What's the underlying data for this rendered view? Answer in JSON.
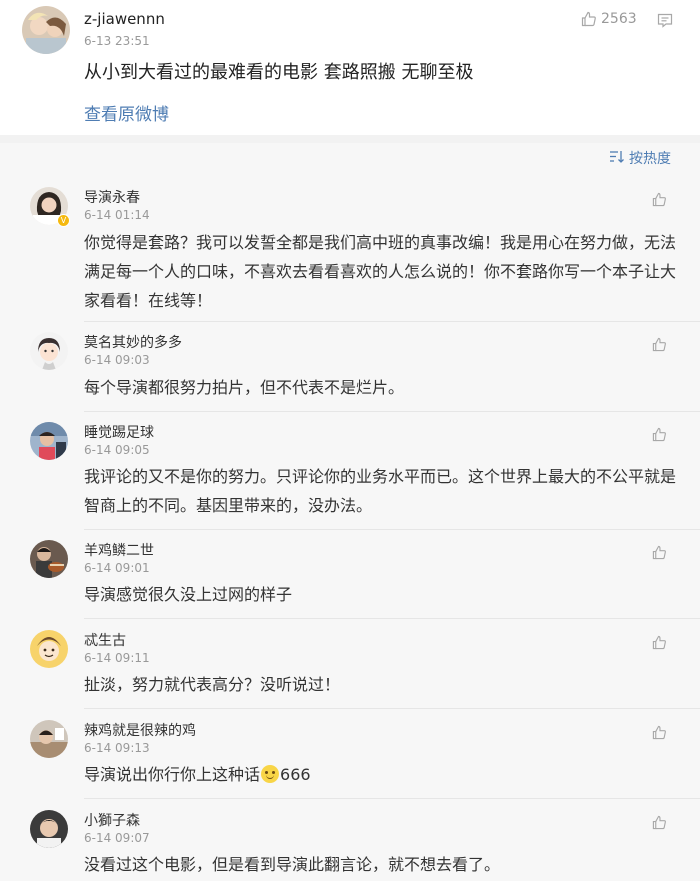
{
  "post": {
    "username": "z-jiawennn",
    "time": "6-13 23:51",
    "text": "从小到大看过的最难看的电影 套路照搬 无聊至极",
    "view_original": "查看原微博",
    "like_count": "2563",
    "icons": {
      "like": "thumbs-up-icon",
      "comment": "comment-icon"
    }
  },
  "sort": {
    "label": "按热度",
    "icon": "sort-icon"
  },
  "comments": [
    {
      "name": "导演永春",
      "time": "6-14 01:14",
      "verified": true,
      "text": "你觉得是套路？我可以发誓全都是我们高中班的真事改编！我是用心在努力做，无法满足每一个人的口味，不喜欢去看看喜欢的人怎么说的！你不套路你写一个本子让大家看看！在线等！"
    },
    {
      "name": "莫名其妙的多多",
      "time": "6-14 09:03",
      "text": "每个导演都很努力拍片，但不代表不是烂片。"
    },
    {
      "name": "睡觉踢足球",
      "time": "6-14 09:05",
      "text": "我评论的又不是你的努力。只评论你的业务水平而已。这个世界上最大的不公平就是智商上的不同。基因里带来的，没办法。"
    },
    {
      "name": "羊鸡鳞二世",
      "time": "6-14 09:01",
      "text": "导演感觉很久没上过网的样子"
    },
    {
      "name": "忒生古",
      "time": "6-14 09:11",
      "text": "扯淡，努力就代表高分？没听说过！"
    },
    {
      "name": "辣鸡就是很辣的鸡",
      "time": "6-14 09:13",
      "text_before": "导演说出你行你上这种话",
      "emoji": "smile-emoji",
      "text_after": "666"
    },
    {
      "name": "小獅子森",
      "time": "6-14 09:07",
      "text": "没看过这个电影，但是看到导演此翻言论，就不想去看了。"
    }
  ],
  "colors": {
    "link": "#4f7db3",
    "list_bg": "#f7f7f7",
    "gray_text": "#999999",
    "verified_badge": "#f5b90f"
  }
}
